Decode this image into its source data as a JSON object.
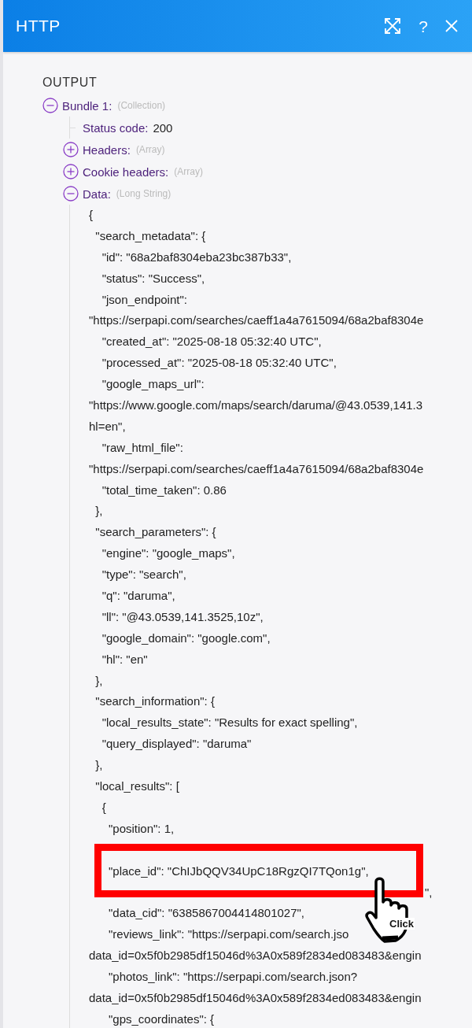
{
  "header": {
    "title": "HTTP",
    "help": "?"
  },
  "output": {
    "title": "OUTPUT",
    "bundles": [
      {
        "label": "Bundle 1:",
        "type": "(Collection)",
        "expanded": true,
        "children": [
          {
            "kind": "value",
            "label": "Status code:",
            "value": "200"
          },
          {
            "kind": "group",
            "label": "Headers:",
            "type": "(Array)",
            "expanded": false
          },
          {
            "kind": "group",
            "label": "Cookie headers:",
            "type": "(Array)",
            "expanded": false
          },
          {
            "kind": "text",
            "label": "Data:",
            "type": "(Long String)",
            "expanded": true,
            "lines": [
              {
                "kind": "code",
                "text": "{"
              },
              {
                "kind": "code",
                "text": "  \"search_metadata\": {"
              },
              {
                "kind": "code",
                "text": "    \"id\": \"68a2baf8304eba23bc387b33\","
              },
              {
                "kind": "code",
                "text": "    \"status\": \"Success\","
              },
              {
                "kind": "code",
                "text": "    \"json_endpoint\":"
              },
              {
                "kind": "code",
                "text": "\"https://serpapi.com/searches/caeff1a4a7615094/68a2baf8304e"
              },
              {
                "kind": "code",
                "text": "    \"created_at\": \"2025-08-18 05:32:40 UTC\","
              },
              {
                "kind": "code",
                "text": "    \"processed_at\": \"2025-08-18 05:32:40 UTC\","
              },
              {
                "kind": "code",
                "text": "    \"google_maps_url\":"
              },
              {
                "kind": "code",
                "text": "\"https://www.google.com/maps/search/daruma/@43.0539,141.3"
              },
              {
                "kind": "code",
                "text": "hl=en\","
              },
              {
                "kind": "code",
                "text": "    \"raw_html_file\":"
              },
              {
                "kind": "code",
                "text": "\"https://serpapi.com/searches/caeff1a4a7615094/68a2baf8304e"
              },
              {
                "kind": "code",
                "text": "    \"total_time_taken\": 0.86"
              },
              {
                "kind": "code",
                "text": "  },"
              },
              {
                "kind": "code",
                "text": "  \"search_parameters\": {"
              },
              {
                "kind": "code",
                "text": "    \"engine\": \"google_maps\","
              },
              {
                "kind": "code",
                "text": "    \"type\": \"search\","
              },
              {
                "kind": "code",
                "text": "    \"q\": \"daruma\","
              },
              {
                "kind": "code",
                "text": "    \"ll\": \"@43.0539,141.3525,10z\","
              },
              {
                "kind": "code",
                "text": "    \"google_domain\": \"google.com\","
              },
              {
                "kind": "code",
                "text": "    \"hl\": \"en\""
              },
              {
                "kind": "code",
                "text": "  },"
              },
              {
                "kind": "code",
                "text": "  \"search_information\": {"
              },
              {
                "kind": "code",
                "text": "    \"local_results_state\": \"Results for exact spelling\","
              },
              {
                "kind": "code",
                "text": "    \"query_displayed\": \"daruma\""
              },
              {
                "kind": "code",
                "text": "  },"
              },
              {
                "kind": "code",
                "text": "  \"local_results\": ["
              },
              {
                "kind": "code",
                "text": "    {"
              },
              {
                "kind": "code",
                "text": "      \"position\": 1,"
              },
              {
                "kind": "blank"
              },
              {
                "kind": "code",
                "text": "      \"place_id\": \"ChIJbQQV34UpC18RgzQI7TQon1g\","
              },
              {
                "kind": "tail",
                "text": "\","
              },
              {
                "kind": "code",
                "text": "      \"data_cid\": \"6385867004414801027\","
              },
              {
                "kind": "code",
                "text": "      \"reviews_link\": \"https://serpapi.com/search.jso"
              },
              {
                "kind": "code",
                "text": "data_id=0x5f0b2985df15046d%3A0x589f2834ed083483&engin"
              },
              {
                "kind": "code",
                "text": "      \"photos_link\": \"https://serpapi.com/search.json?"
              },
              {
                "kind": "code",
                "text": "data_id=0x5f0b2985df15046d%3A0x589f2834ed083483&engin"
              },
              {
                "kind": "code",
                "text": "      \"gps_coordinates\": {"
              }
            ]
          }
        ]
      }
    ]
  },
  "annotation": {
    "label": "Click"
  }
}
